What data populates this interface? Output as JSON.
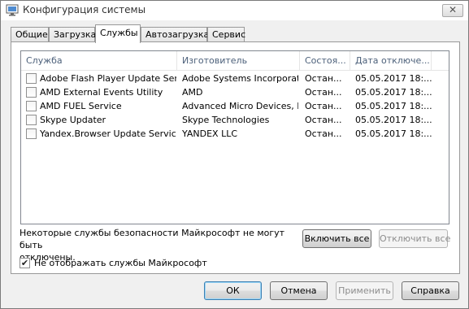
{
  "window": {
    "title": "Конфигурация системы",
    "close_glyph": "✕"
  },
  "tabs": [
    {
      "label": "Общие"
    },
    {
      "label": "Загрузка"
    },
    {
      "label": "Службы"
    },
    {
      "label": "Автозагрузка"
    },
    {
      "label": "Сервис"
    }
  ],
  "services": {
    "columns": [
      "Служба",
      "Изготовитель",
      "Состоя...",
      "Дата отключе..."
    ],
    "rows": [
      {
        "name": "Adobe Flash Player Update Service",
        "maker": "Adobe Systems Incorporated",
        "status": "Остан...",
        "date": "05.05.2017 18:..."
      },
      {
        "name": "AMD External Events Utility",
        "maker": "AMD",
        "status": "Остан...",
        "date": "05.05.2017 18:..."
      },
      {
        "name": "AMD FUEL Service",
        "maker": "Advanced Micro Devices, I...",
        "status": "Остан...",
        "date": "05.05.2017 18:..."
      },
      {
        "name": "Skype Updater",
        "maker": "Skype Technologies",
        "status": "Остан...",
        "date": "05.05.2017 18:..."
      },
      {
        "name": "Yandex.Browser Update Service",
        "maker": "YANDEX LLC",
        "status": "Остан...",
        "date": "05.05.2017 18:..."
      }
    ]
  },
  "note": {
    "line1": "Некоторые службы безопасности Майкрософт не могут быть",
    "line2": "отключены."
  },
  "buttons": {
    "enable_all": "Включить все",
    "disable_all": "Отключить все",
    "ok": "ОК",
    "cancel": "Отмена",
    "apply": "Применить",
    "help": "Справка"
  },
  "hide_ms": {
    "label": "Не отображать службы Майкрософт",
    "checked": true,
    "check_glyph": "✔"
  }
}
